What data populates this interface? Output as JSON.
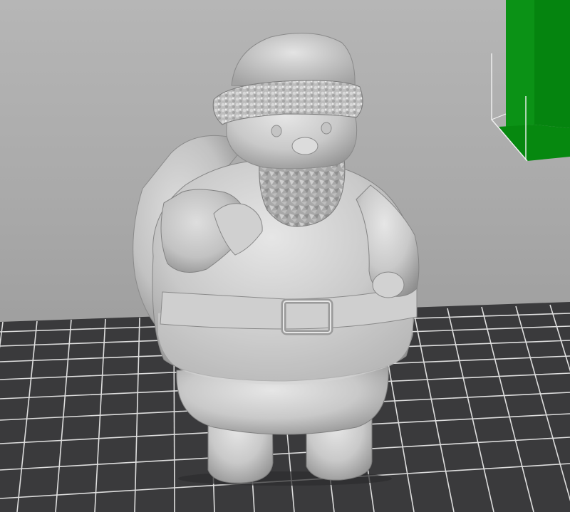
{
  "viewport": {
    "background_color": "#a9a9a9",
    "bed_color": "#3a3a3c",
    "grid_line_color": "#e0e0e0",
    "model_color": "#c8c8c8",
    "volume_box_color": "#0a8a14",
    "icons": [
      "print-bed-grid",
      "santa-3d-model",
      "build-volume-corner"
    ]
  }
}
